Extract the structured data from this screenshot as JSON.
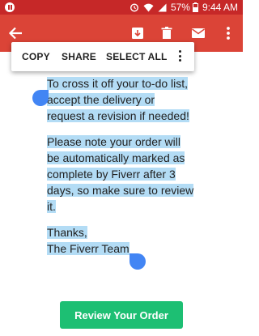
{
  "status_bar": {
    "battery_percent": "57%",
    "time": "9:44 AM"
  },
  "appbar": {
    "back_icon": "arrow-back-icon",
    "actions": [
      "archive-icon",
      "delete-icon",
      "mail-icon",
      "more-vert-icon"
    ],
    "color": "#db4437"
  },
  "selection_menu": {
    "items": [
      "COPY",
      "SHARE",
      "SELECT ALL"
    ],
    "more_icon": "more-vert-icon"
  },
  "email": {
    "paragraph1": [
      "To cross it off your to-do list,",
      "accept the delivery or",
      "request a revision if needed!"
    ],
    "paragraph2": [
      "Please note your order will",
      "be automatically marked as",
      "complete by Fiverr after 3",
      "days, so make sure to review",
      "it."
    ],
    "paragraph3": [
      "Thanks,",
      "The Fiverr Team"
    ]
  },
  "review_button": {
    "label": "Review Your Order",
    "color": "#1dbf73"
  },
  "colors": {
    "status_bar": "#c62828",
    "selection_highlight": "#b3dcf5",
    "selection_handle": "#4285f4"
  }
}
